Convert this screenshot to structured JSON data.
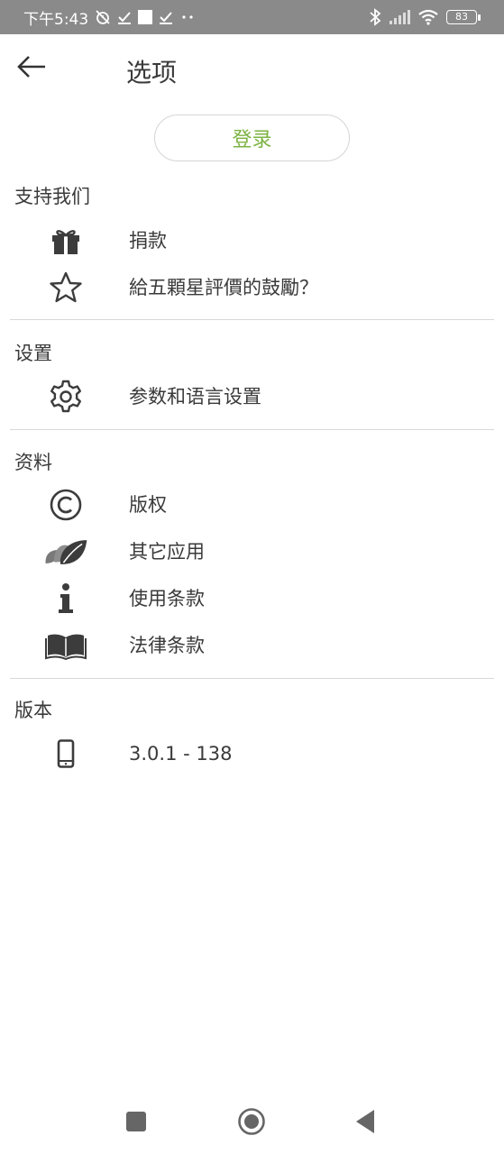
{
  "status_bar": {
    "time": "下午5:43",
    "battery": "83",
    "icons": [
      "alarm-off-icon",
      "check-icon",
      "square-icon",
      "check-icon",
      "more-dots-icon",
      "bluetooth-icon",
      "signal-icon",
      "wifi-icon",
      "battery-icon"
    ]
  },
  "header": {
    "title": "选项",
    "back_icon": "arrow-left-icon"
  },
  "login": {
    "label": "登录",
    "color": "#7cb342"
  },
  "sections": {
    "support": {
      "title": "支持我们",
      "items": [
        {
          "label": "捐款",
          "icon": "gift-icon"
        },
        {
          "label": "給五顆星評價的鼓勵？",
          "icon": "star-icon"
        }
      ]
    },
    "settings": {
      "title": "设置",
      "items": [
        {
          "label": "参数和语言设置",
          "icon": "gear-icon"
        }
      ]
    },
    "info": {
      "title": "资料",
      "items": [
        {
          "label": "版权",
          "icon": "copyright-icon"
        },
        {
          "label": "其它应用",
          "icon": "leaves-icon"
        },
        {
          "label": "使用条款",
          "icon": "info-icon"
        },
        {
          "label": "法律条款",
          "icon": "book-icon"
        }
      ]
    },
    "version": {
      "title": "版本",
      "items": [
        {
          "label": "3.0.1 - 138",
          "icon": "phone-icon"
        }
      ]
    }
  },
  "nav_bar": {
    "icons": [
      "recents-icon",
      "home-icon",
      "back-icon"
    ]
  }
}
